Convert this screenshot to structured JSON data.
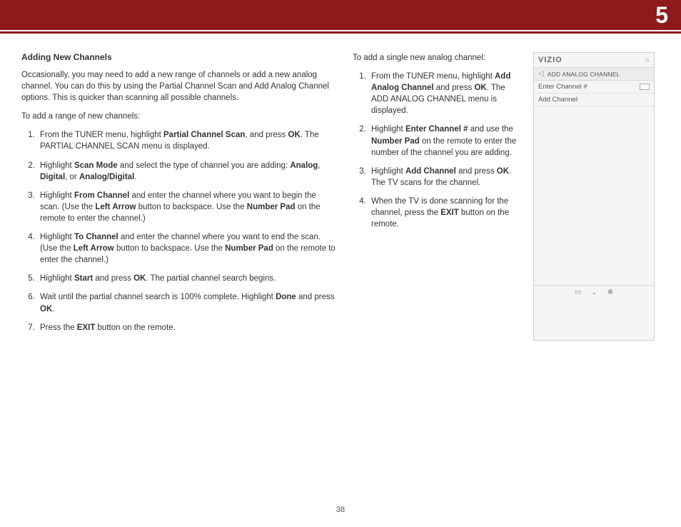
{
  "header": {
    "section": "5"
  },
  "left": {
    "title": "Adding New Channels",
    "intro": "Occasionally, you may need to add a new range of channels  or add a new analog channel. You can do this by using the Partial Channel Scan and Add Analog Channel options. This is quicker than scanning all possible channels.",
    "lead": "To add a range of new channels:",
    "s1a": "From the TUNER menu, highlight ",
    "s1b": "Partial Channel Scan",
    "s1c": ", and press ",
    "s1d": "OK",
    "s1e": ". The PARTIAL CHANNEL SCAN menu is displayed.",
    "s2a": "Highlight ",
    "s2b": "Scan Mode",
    "s2c": " and select the type of channel you are adding: ",
    "s2d": "Analog",
    "s2e": ", ",
    "s2f": "Digital",
    "s2g": ", or ",
    "s2h": "Analog/Digital",
    "s2i": ".",
    "s3a": "Highlight ",
    "s3b": "From Channel",
    "s3c": " and enter the channel where you want to begin the scan. (Use the ",
    "s3d": "Left Arrow",
    "s3e": "  button to backspace. Use the ",
    "s3f": "Number Pad",
    "s3g": " on the remote to enter the channel.)",
    "s4a": "Highlight ",
    "s4b": "To Channel",
    "s4c": " and enter the channel where you want to end the scan. (Use the ",
    "s4d": "Left Arrow",
    "s4e": "  button to backspace. Use the ",
    "s4f": "Number Pad",
    "s4g": " on the remote to enter the channel.)",
    "s5a": "Highlight ",
    "s5b": "Start",
    "s5c": " and press ",
    "s5d": "OK",
    "s5e": ". The partial channel search begins.",
    "s6a": "Wait until the partial channel search is 100% complete. Highlight ",
    "s6b": "Done",
    "s6c": " and press ",
    "s6d": "OK",
    "s6e": ".",
    "s7a": "Press the ",
    "s7b": "EXIT",
    "s7c": " button on the remote."
  },
  "right": {
    "lead": "To add a single new analog channel:",
    "r1a": "From the TUNER menu, highlight ",
    "r1b": "Add Analog Channel",
    "r1c": " and press ",
    "r1d": "OK",
    "r1e": ". The ADD ANALOG CHANNEL menu is displayed.",
    "r2a": "Highlight ",
    "r2b": "Enter Channel #",
    "r2c": " and use the ",
    "r2d": "Number Pad",
    "r2e": " on the remote to enter the number of the channel you are adding.",
    "r3a": "Highlight ",
    "r3b": "Add Channel",
    "r3c": " and press ",
    "r3d": "OK",
    "r3e": ". The TV scans for the channel.",
    "r4a": "When the TV is done scanning for the channel, press the ",
    "r4b": "EXIT",
    "r4c": " button on the remote."
  },
  "menu": {
    "brand": "VIZIO",
    "crumb": "ADD ANALOG CHANNEL",
    "row1": "Enter Channel #",
    "row2": "Add Channel"
  },
  "page": "38"
}
